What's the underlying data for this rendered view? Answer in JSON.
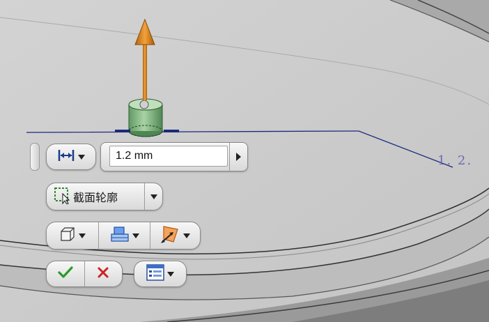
{
  "dimension_input": {
    "value": "1.2 mm"
  },
  "profile_button": {
    "label": "截面轮廓"
  },
  "annotation": {
    "label": "1. 2."
  },
  "icons": {
    "distance": "distance-icon",
    "profile": "profile-select-icon",
    "solid": "solid-box-icon",
    "output": "output-icon",
    "direction": "direction-icon",
    "ok": "checkmark-icon",
    "cancel": "cross-icon",
    "options": "options-list-icon"
  },
  "colors": {
    "background": "#d6d6d6",
    "ok_green": "#2a9a2a",
    "cancel_red": "#cc2222",
    "manipulator_orange": "#e08a1a",
    "cylinder_green": "#7bb07b",
    "sketch_line": "#1a2a7a",
    "annotation_text": "#6a6ab4"
  }
}
